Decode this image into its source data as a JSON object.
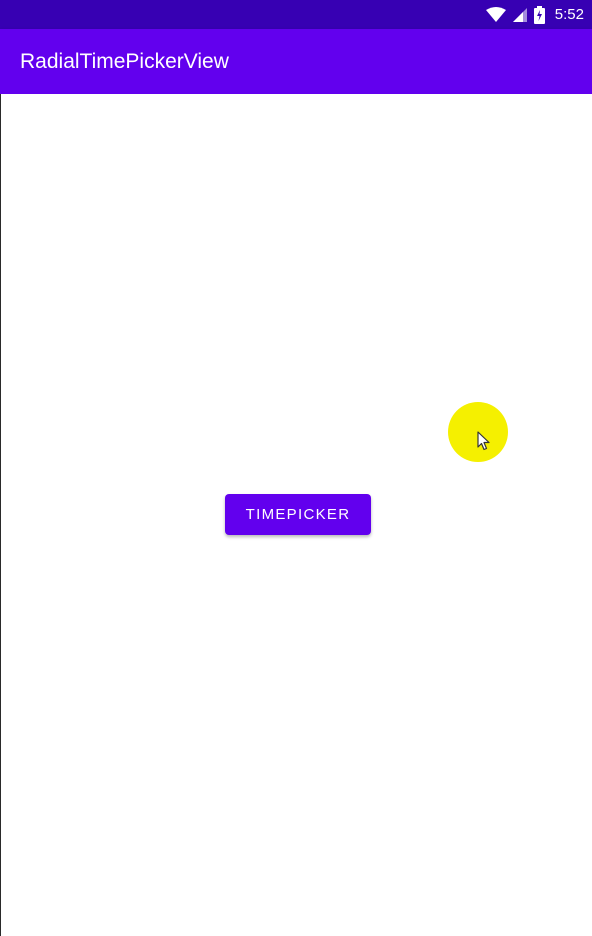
{
  "status_bar": {
    "time": "5:52",
    "icons": [
      "wifi-icon",
      "signal-icon",
      "battery-charging-icon"
    ],
    "background": "#3700b3"
  },
  "app_bar": {
    "title": "RadialTimePickerView",
    "background": "#6200ee"
  },
  "main": {
    "button_label": "TIMEPICKER",
    "button_color": "#6200ee"
  },
  "overlay": {
    "touch_indicator_color": "#f5f000",
    "cursor": "arrow-cursor-icon"
  }
}
